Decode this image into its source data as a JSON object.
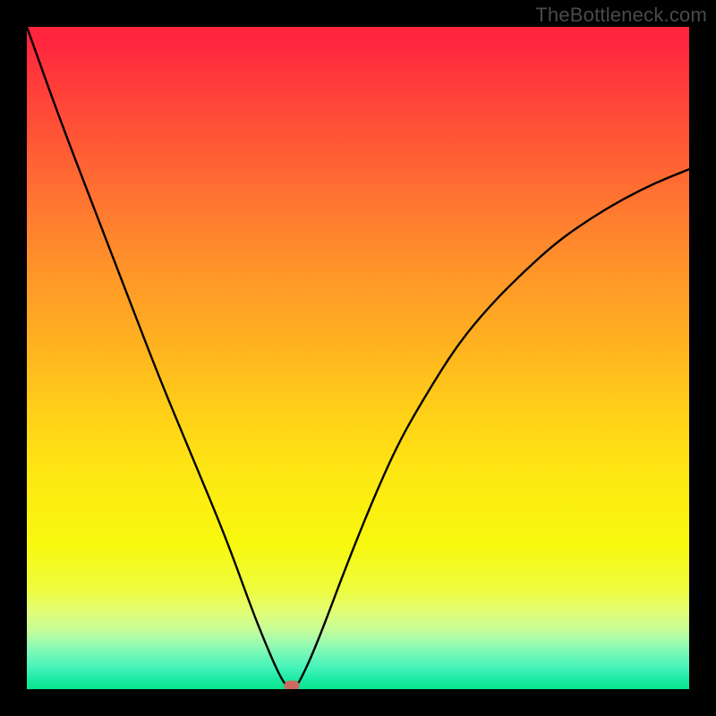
{
  "watermark": "TheBottleneck.com",
  "chart_data": {
    "type": "line",
    "title": "",
    "xlabel": "",
    "ylabel": "",
    "xlim": [
      0,
      100
    ],
    "ylim": [
      0,
      100
    ],
    "background_gradient": {
      "top": "#ff253e",
      "bottom": "#08e48e",
      "meaning": "bottleneck severity (red=high, green=low)"
    },
    "series": [
      {
        "name": "bottleneck-curve",
        "color": "#000000",
        "x": [
          0,
          5,
          10,
          15,
          20,
          25,
          30,
          34,
          36,
          37.5,
          38.5,
          39.2,
          40,
          40.8,
          41.5,
          43,
          45,
          48,
          52,
          56,
          60,
          65,
          70,
          75,
          80,
          85,
          90,
          95,
          100
        ],
        "y": [
          100,
          86,
          73,
          60,
          47,
          35,
          23,
          12,
          7,
          3.5,
          1.5,
          0.5,
          0.2,
          0.6,
          1.8,
          5,
          10,
          18,
          28,
          37,
          44,
          52,
          58,
          63,
          67.5,
          71,
          74,
          76.5,
          78.5
        ]
      }
    ],
    "marker": {
      "name": "optimal-point",
      "x": 40,
      "y": 0.5,
      "color": "#c96a60"
    },
    "grid": false,
    "legend": false
  }
}
